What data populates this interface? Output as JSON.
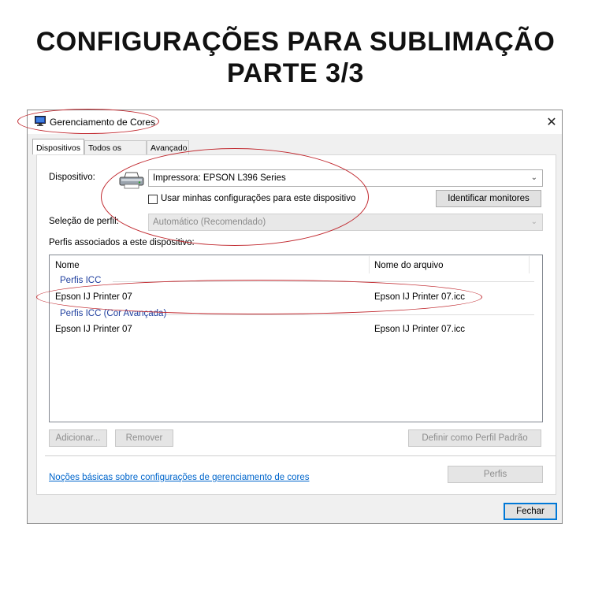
{
  "headline": {
    "line1": "CONFIGURAÇÕES PARA SUBLIMAÇÃO",
    "line2": "PARTE 3/3"
  },
  "window": {
    "title": "Gerenciamento de Cores",
    "close_glyph": "✕",
    "tabs": [
      {
        "label": "Dispositivos",
        "active": true
      },
      {
        "label": "Todos os Perfis",
        "active": false
      },
      {
        "label": "Avançado",
        "active": false
      }
    ]
  },
  "device": {
    "label": "Dispositivo:",
    "value": "Impressora: EPSON L396 Series",
    "checkbox_label": "Usar minhas configurações para este dispositivo",
    "checkbox_checked": false,
    "identify_button": "Identificar monitores",
    "profile_selection_label": "Seleção de perfil:",
    "profile_selection_value": "Automático (Recomendado)"
  },
  "profiles": {
    "section_label": "Perfis associados a este dispositivo:",
    "columns": [
      "Nome",
      "Nome do arquivo"
    ],
    "groups": [
      {
        "name": "Perfis ICC",
        "rows": [
          {
            "name": "Epson IJ Printer 07",
            "file": "Epson IJ Printer 07.icc"
          }
        ]
      },
      {
        "name": "Perfis ICC (Cor Avançada)",
        "rows": [
          {
            "name": "Epson IJ Printer 07",
            "file": "Epson IJ Printer 07.icc"
          }
        ]
      }
    ]
  },
  "buttons": {
    "add": "Adicionar...",
    "remove": "Remover",
    "set_default": "Definir como Perfil Padrão",
    "profiles": "Perfis",
    "close": "Fechar"
  },
  "help_link": "Noções básicas sobre configurações de gerenciamento de cores",
  "annotation_color": "#c0272d"
}
